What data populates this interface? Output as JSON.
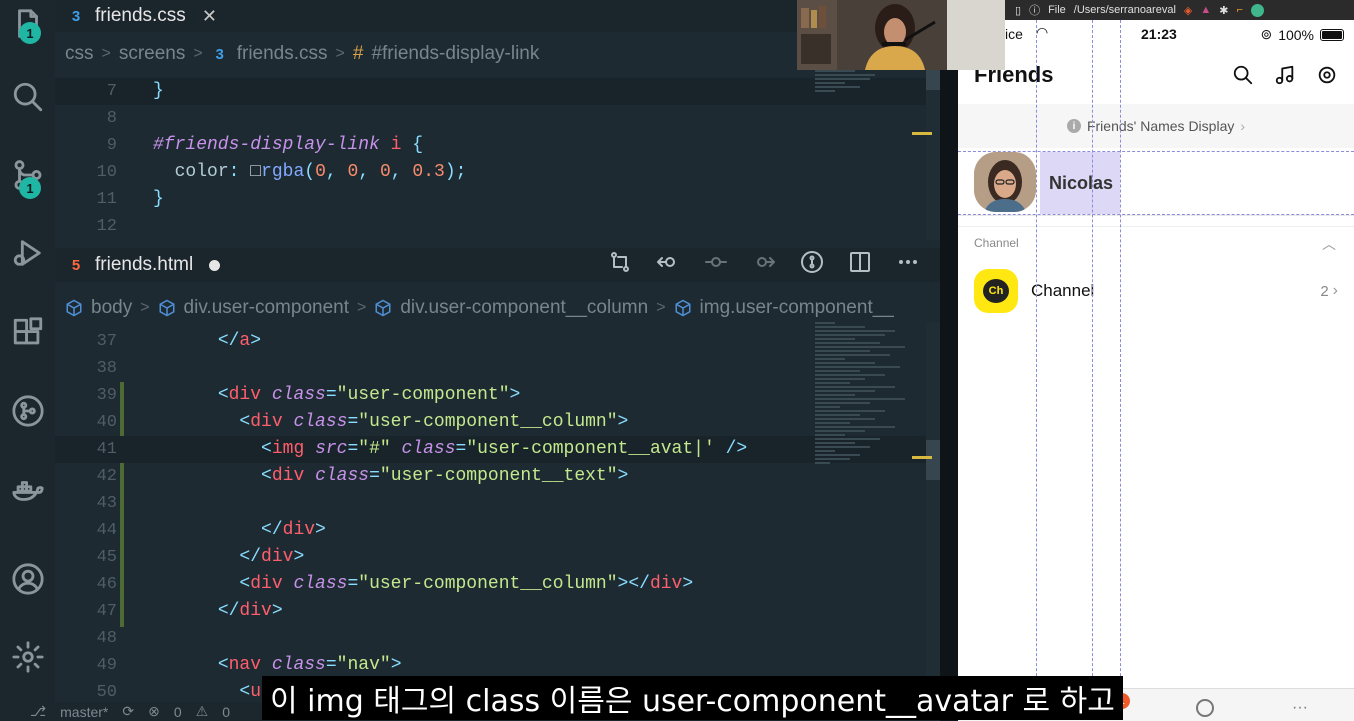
{
  "activity_bar": {
    "explorer_badge": "1",
    "scm_badge": "1"
  },
  "css_editor": {
    "tab_label": "friends.css",
    "breadcrumb": [
      "css",
      "screens",
      "friends.css",
      "#friends-display-link"
    ],
    "lines": [
      {
        "n": "7",
        "html": "<span class='tk-punc'>}</span>"
      },
      {
        "n": "8",
        "html": ""
      },
      {
        "n": "9",
        "html": "<span class='tk-sel'>#friends-display-link</span> <span class='tk-tag'>i</span> <span class='tk-punc'>{</span>"
      },
      {
        "n": "10",
        "html": "  <span class='tk-prop'>color</span><span class='tk-punc'>:</span> <span class='tk-text'>&#9633;</span><span class='tk-fn'>rgba</span><span class='tk-punc'>(</span><span class='tk-num'>0</span><span class='tk-punc'>,</span> <span class='tk-num'>0</span><span class='tk-punc'>,</span> <span class='tk-num'>0</span><span class='tk-punc'>,</span> <span class='tk-num'>0.3</span><span class='tk-punc'>);</span>"
      },
      {
        "n": "11",
        "html": "<span class='tk-punc'>}</span>"
      },
      {
        "n": "12",
        "html": ""
      }
    ]
  },
  "html_editor": {
    "tab_label": "friends.html",
    "breadcrumb": [
      "body",
      "div.user-component",
      "div.user-component__column",
      "img.user-component__"
    ],
    "lines": [
      {
        "n": "37",
        "html": "      <span class='tk-punc'>&lt;/</span><span class='tk-tag'>a</span><span class='tk-punc'>&gt;</span>"
      },
      {
        "n": "38",
        "html": ""
      },
      {
        "n": "39",
        "html": "      <span class='tk-punc'>&lt;</span><span class='tk-tag'>div</span> <span class='tk-attr'>class</span><span class='tk-punc'>=</span><span class='tk-str'>\"user-component\"</span><span class='tk-punc'>&gt;</span>"
      },
      {
        "n": "40",
        "html": "        <span class='tk-punc'>&lt;</span><span class='tk-tag'>div</span> <span class='tk-attr'>class</span><span class='tk-punc'>=</span><span class='tk-str'>\"user-component__column\"</span><span class='tk-punc'>&gt;</span>"
      },
      {
        "n": "41",
        "html": "          <span class='tk-punc'>&lt;</span><span class='tk-tag'>img</span> <span class='tk-attr'>src</span><span class='tk-punc'>=</span><span class='tk-str'>\"#\"</span> <span class='tk-attr'>class</span><span class='tk-punc'>=</span><span class='tk-str'>\"user-component__avat|'</span> <span class='tk-punc'>/&gt;</span>"
      },
      {
        "n": "42",
        "html": "          <span class='tk-punc'>&lt;</span><span class='tk-tag'>div</span> <span class='tk-attr'>class</span><span class='tk-punc'>=</span><span class='tk-str'>\"user-component__text\"</span><span class='tk-punc'>&gt;</span>"
      },
      {
        "n": "43",
        "html": ""
      },
      {
        "n": "44",
        "html": "          <span class='tk-punc'>&lt;/</span><span class='tk-tag'>div</span><span class='tk-punc'>&gt;</span>"
      },
      {
        "n": "45",
        "html": "        <span class='tk-punc'>&lt;/</span><span class='tk-tag'>div</span><span class='tk-punc'>&gt;</span>"
      },
      {
        "n": "46",
        "html": "        <span class='tk-punc'>&lt;</span><span class='tk-tag'>div</span> <span class='tk-attr'>class</span><span class='tk-punc'>=</span><span class='tk-str'>\"user-component__column\"</span><span class='tk-punc'>&gt;&lt;/</span><span class='tk-tag'>div</span><span class='tk-punc'>&gt;</span>"
      },
      {
        "n": "47",
        "html": "      <span class='tk-punc'>&lt;/</span><span class='tk-tag'>div</span><span class='tk-punc'>&gt;</span>"
      },
      {
        "n": "48",
        "html": ""
      },
      {
        "n": "49",
        "html": "      <span class='tk-punc'>&lt;</span><span class='tk-tag'>nav</span> <span class='tk-attr'>class</span><span class='tk-punc'>=</span><span class='tk-str'>\"nav\"</span><span class='tk-punc'>&gt;</span>"
      },
      {
        "n": "50",
        "html": "        <span class='tk-punc'>&lt;</span><span class='tk-tag'>ul</span>"
      }
    ]
  },
  "browser_bar": {
    "file_label": "File",
    "path": "/Users/serranoareval"
  },
  "phone": {
    "status": {
      "device": "vice",
      "time": "21:23",
      "battery": "100%"
    },
    "header_title": "Friends",
    "names_display_label": "Friends' Names Display",
    "user_name": "Nicolas",
    "section_label": "Channel",
    "channel": {
      "icon_text": "Ch",
      "name": "Channel",
      "count": "2"
    },
    "bottom_badge": "1"
  },
  "status_bottom": {
    "branch": "master*",
    "errors": "0",
    "warnings": "0"
  },
  "subtitle": "이 img 태그의 class 이름은 user-component__avatar 로 하고"
}
